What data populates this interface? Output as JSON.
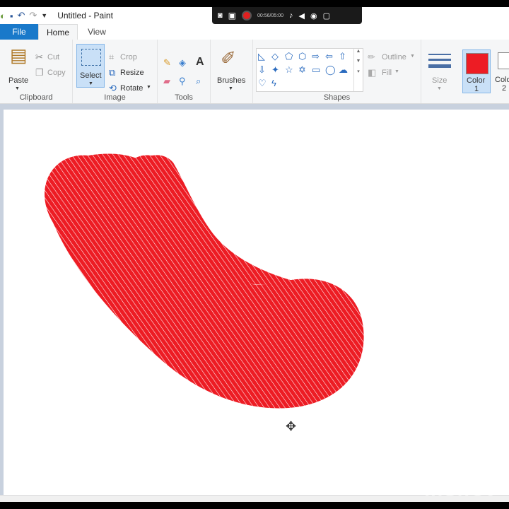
{
  "title_bar": {
    "title": "Untitled - Paint"
  },
  "recorder": {
    "timer": "00:56/05:00"
  },
  "menu": {
    "file": "File",
    "home": "Home",
    "view": "View"
  },
  "clipboard": {
    "paste": "Paste",
    "cut": "Cut",
    "copy": "Copy",
    "group": "Clipboard"
  },
  "image": {
    "select": "Select",
    "crop": "Crop",
    "resize": "Resize",
    "rotate": "Rotate",
    "group": "Image"
  },
  "tools": {
    "group": "Tools"
  },
  "brushes": {
    "label": "Brushes"
  },
  "shapes": {
    "outline": "Outline",
    "fill": "Fill",
    "group": "Shapes"
  },
  "size": {
    "label": "Size"
  },
  "colors": {
    "color1_line1": "Color",
    "color1_line2": "1",
    "color2_line1": "Colo",
    "color2_line2": "2",
    "primary": "#ed1c24",
    "secondary": "#ffffff"
  },
  "watermark": "InShOt"
}
